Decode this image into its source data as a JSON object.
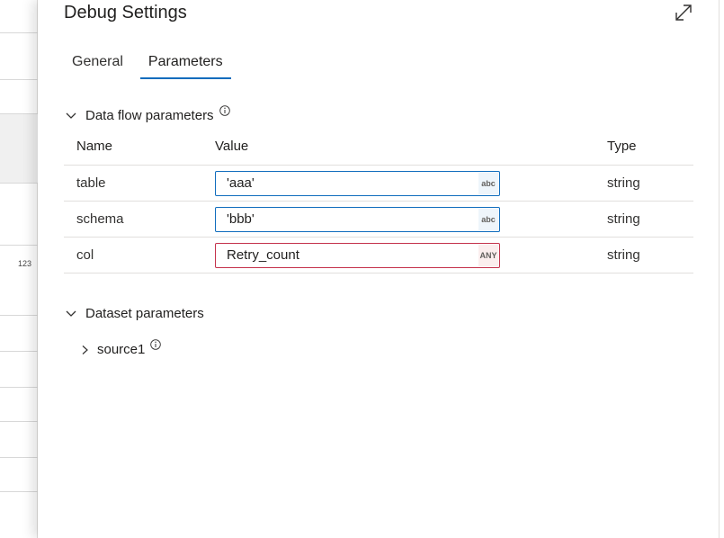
{
  "background": {
    "row_number": "123"
  },
  "panel": {
    "title": "Debug Settings",
    "tabs": [
      {
        "label": "General",
        "active": false
      },
      {
        "label": "Parameters",
        "active": true
      }
    ],
    "data_flow_section": {
      "label": "Data flow parameters",
      "expanded": true,
      "columns": {
        "name": "Name",
        "value": "Value",
        "type": "Type"
      },
      "rows": [
        {
          "name": "table",
          "value": "'aaa'",
          "type_tag": "abc",
          "type": "string",
          "state": "ok"
        },
        {
          "name": "schema",
          "value": "'bbb'",
          "type_tag": "abc",
          "type": "string",
          "state": "ok"
        },
        {
          "name": "col",
          "value": "Retry_count",
          "type_tag": "ANY",
          "type": "string",
          "state": "error"
        }
      ]
    },
    "dataset_section": {
      "label": "Dataset parameters",
      "expanded": true,
      "items": [
        {
          "label": "source1",
          "expanded": false
        }
      ]
    }
  },
  "colors": {
    "accent": "#0f6cbd",
    "error": "#c4314b",
    "text": "#323130"
  }
}
